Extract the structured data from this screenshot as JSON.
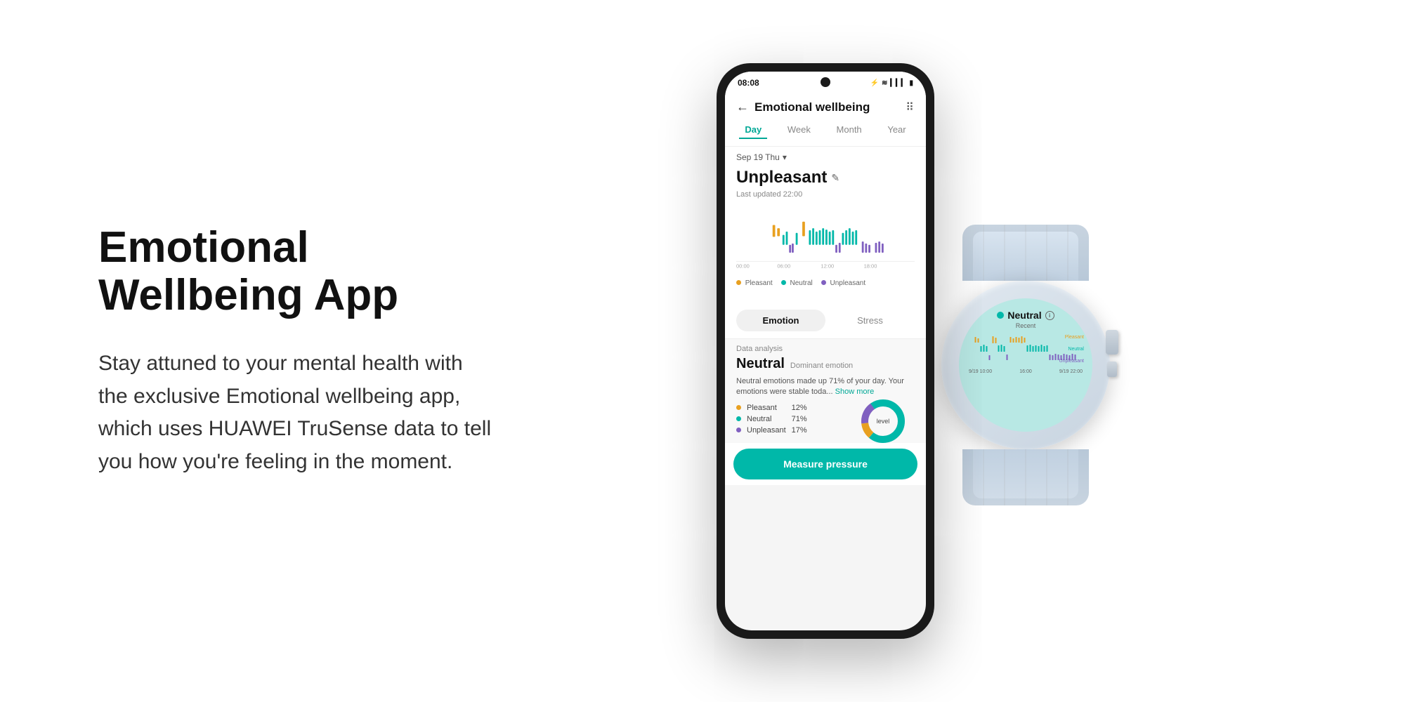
{
  "page": {
    "background": "#ffffff"
  },
  "text_section": {
    "title": "Emotional Wellbeing App",
    "description": "Stay attuned to your mental health with the exclusive Emotional wellbeing app, which uses HUAWEI TruSense data to tell you how you're feeling in the moment."
  },
  "phone": {
    "status_bar": {
      "time": "08:08",
      "icons": "⚡ ≋ ▲▲▲ 🔋"
    },
    "app": {
      "title": "Emotional wellbeing",
      "tabs": [
        "Day",
        "Week",
        "Month",
        "Year"
      ],
      "active_tab": "Day",
      "date": "Sep 19 Thu",
      "emotion_status": "Unpleasant",
      "last_updated": "Last updated 22:00",
      "data_analysis_label": "Data analysis",
      "dominant_emotion": "Neutral",
      "dominant_sub": "Dominant emotion",
      "emotion_desc": "Neutral emotions made up 71% of your day. Your emotions were stable toda...",
      "show_more": "Show more",
      "toggle_emotion": "Emotion",
      "toggle_stress": "Stress",
      "breakdown": [
        {
          "label": "Pleasant",
          "value": "12%",
          "color": "#e8a020"
        },
        {
          "label": "Neutral",
          "value": "71%",
          "color": "#00b8a9"
        },
        {
          "label": "Unpleasant",
          "value": "17%",
          "color": "#8060c0"
        }
      ],
      "measure_btn": "Measure pressure",
      "legend": [
        {
          "label": "Pleasant",
          "color": "#e8a020"
        },
        {
          "label": "Neutral",
          "color": "#00b8a9"
        },
        {
          "label": "Unpleasant",
          "color": "#8060c0"
        }
      ],
      "time_labels": [
        "00:00",
        "06:00",
        "12:00",
        "18:00"
      ]
    }
  },
  "watch": {
    "neutral_label": "Neutral",
    "recent_label": "Recent",
    "info_icon": "i",
    "time_labels": [
      "9/19 10:00",
      "16:00",
      "9/19 22:00"
    ],
    "emotion_labels": [
      "Pleasant",
      "Neutral",
      "Unpleasant"
    ]
  }
}
